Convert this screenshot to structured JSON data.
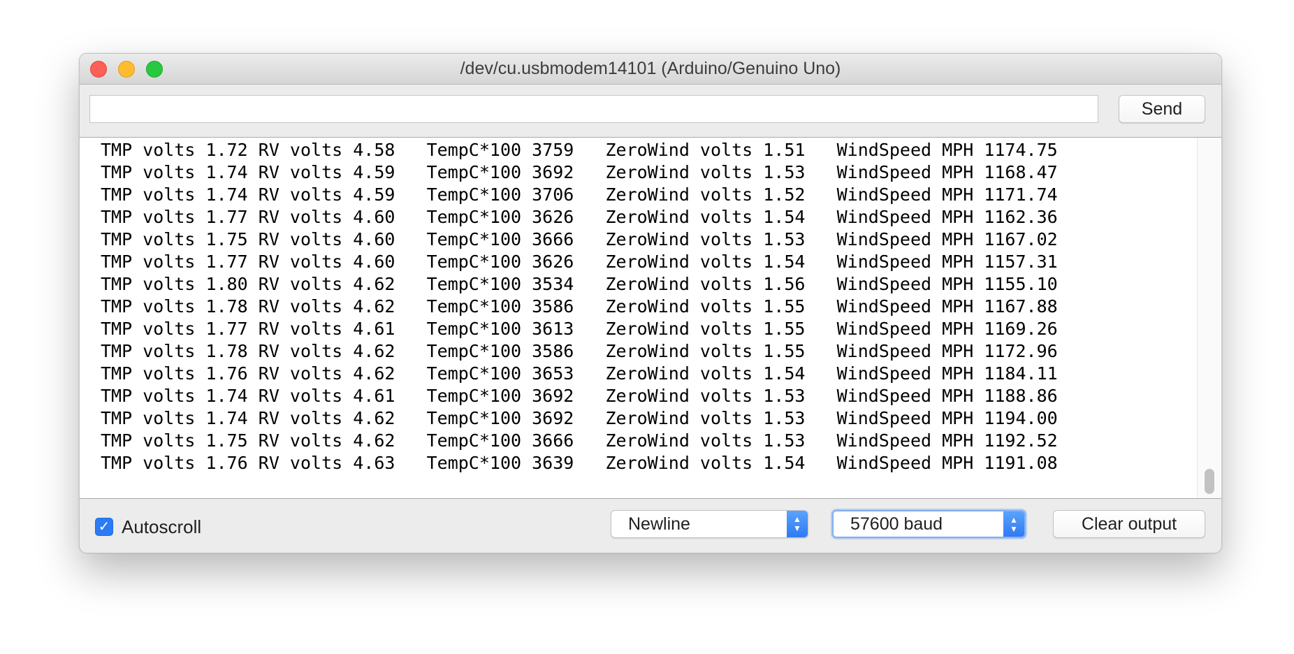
{
  "window": {
    "title": "/dev/cu.usbmodem14101 (Arduino/Genuino Uno)"
  },
  "send_bar": {
    "input_value": "",
    "send_label": "Send"
  },
  "output_lines": [
    "TMP volts 1.72 RV volts 4.58   TempC*100 3759   ZeroWind volts 1.51   WindSpeed MPH 1174.75",
    "TMP volts 1.74 RV volts 4.59   TempC*100 3692   ZeroWind volts 1.53   WindSpeed MPH 1168.47",
    "TMP volts 1.74 RV volts 4.59   TempC*100 3706   ZeroWind volts 1.52   WindSpeed MPH 1171.74",
    "TMP volts 1.77 RV volts 4.60   TempC*100 3626   ZeroWind volts 1.54   WindSpeed MPH 1162.36",
    "TMP volts 1.75 RV volts 4.60   TempC*100 3666   ZeroWind volts 1.53   WindSpeed MPH 1167.02",
    "TMP volts 1.77 RV volts 4.60   TempC*100 3626   ZeroWind volts 1.54   WindSpeed MPH 1157.31",
    "TMP volts 1.80 RV volts 4.62   TempC*100 3534   ZeroWind volts 1.56   WindSpeed MPH 1155.10",
    "TMP volts 1.78 RV volts 4.62   TempC*100 3586   ZeroWind volts 1.55   WindSpeed MPH 1167.88",
    "TMP volts 1.77 RV volts 4.61   TempC*100 3613   ZeroWind volts 1.55   WindSpeed MPH 1169.26",
    "TMP volts 1.78 RV volts 4.62   TempC*100 3586   ZeroWind volts 1.55   WindSpeed MPH 1172.96",
    "TMP volts 1.76 RV volts 4.62   TempC*100 3653   ZeroWind volts 1.54   WindSpeed MPH 1184.11",
    "TMP volts 1.74 RV volts 4.61   TempC*100 3692   ZeroWind volts 1.53   WindSpeed MPH 1188.86",
    "TMP volts 1.74 RV volts 4.62   TempC*100 3692   ZeroWind volts 1.53   WindSpeed MPH 1194.00",
    "TMP volts 1.75 RV volts 4.62   TempC*100 3666   ZeroWind volts 1.53   WindSpeed MPH 1192.52",
    "TMP volts 1.76 RV volts 4.63   TempC*100 3639   ZeroWind volts 1.54   WindSpeed MPH 1191.08"
  ],
  "footer": {
    "autoscroll_label": "Autoscroll",
    "autoscroll_checked": true,
    "line_ending": "Newline",
    "baud_rate": "57600 baud",
    "clear_label": "Clear output"
  },
  "colors": {
    "accent": "#2c7bf6",
    "close": "#fe5f57",
    "minimize": "#febc2e",
    "maximize": "#28c840"
  },
  "icons": {
    "check": "checkmark-icon",
    "select_arrows": "chevron-up-down-icon"
  }
}
